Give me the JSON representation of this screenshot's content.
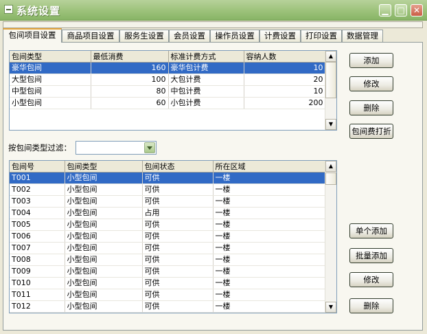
{
  "window": {
    "title": "系统设置"
  },
  "tabs": [
    "包间项目设置",
    "商品项目设置",
    "服务生设置",
    "会员设置",
    "操作员设置",
    "计费设置",
    "打印设置",
    "数据管理"
  ],
  "room_types": {
    "columns": [
      "包间类型",
      "最低消费",
      "标准计费方式",
      "容纳人数"
    ],
    "rows": [
      {
        "type": "豪华包间",
        "min_spend": "160",
        "billing": "豪华包计费",
        "capacity": "10"
      },
      {
        "type": "大型包间",
        "min_spend": "100",
        "billing": "大包计费",
        "capacity": "20"
      },
      {
        "type": "中型包间",
        "min_spend": "80",
        "billing": "中包计费",
        "capacity": "10"
      },
      {
        "type": "小型包间",
        "min_spend": "60",
        "billing": "小包计费",
        "capacity": "200"
      }
    ],
    "selected_index": 0
  },
  "room_type_buttons": {
    "add": "添加",
    "edit": "修改",
    "delete": "删除",
    "discount": "包间费打折"
  },
  "filter": {
    "label": "按包间类型过滤：",
    "value": ""
  },
  "rooms": {
    "columns": [
      "包间号",
      "包间类型",
      "包间状态",
      "所在区域"
    ],
    "rows": [
      {
        "id": "T001",
        "type": "小型包间",
        "status": "可供",
        "area": "一楼"
      },
      {
        "id": "T002",
        "type": "小型包间",
        "status": "可供",
        "area": "一楼"
      },
      {
        "id": "T003",
        "type": "小型包间",
        "status": "可供",
        "area": "一楼"
      },
      {
        "id": "T004",
        "type": "小型包间",
        "status": "占用",
        "area": "一楼"
      },
      {
        "id": "T005",
        "type": "小型包间",
        "status": "可供",
        "area": "一楼"
      },
      {
        "id": "T006",
        "type": "小型包间",
        "status": "可供",
        "area": "一楼"
      },
      {
        "id": "T007",
        "type": "小型包间",
        "status": "可供",
        "area": "一楼"
      },
      {
        "id": "T008",
        "type": "小型包间",
        "status": "可供",
        "area": "一楼"
      },
      {
        "id": "T009",
        "type": "小型包间",
        "status": "可供",
        "area": "一楼"
      },
      {
        "id": "T010",
        "type": "小型包间",
        "status": "可供",
        "area": "一楼"
      },
      {
        "id": "T011",
        "type": "小型包间",
        "status": "可供",
        "area": "一楼"
      },
      {
        "id": "T012",
        "type": "小型包间",
        "status": "可供",
        "area": "一楼"
      }
    ],
    "selected_index": 0
  },
  "room_buttons": {
    "single_add": "单个添加",
    "batch_add": "批量添加",
    "edit": "修改",
    "delete": "删除"
  },
  "icons": {
    "window": "window-menu-icon",
    "minimize": "minimize-icon",
    "maximize": "maximize-icon",
    "close": "close-icon",
    "scroll_up": "scroll-up-arrow-icon",
    "scroll_down": "scroll-down-arrow-icon",
    "dropdown": "chevron-down-icon"
  },
  "colors": {
    "selection": "#316ac5",
    "titlebar": "#9cc27a",
    "active_tab_accent": "#e6a63d"
  }
}
